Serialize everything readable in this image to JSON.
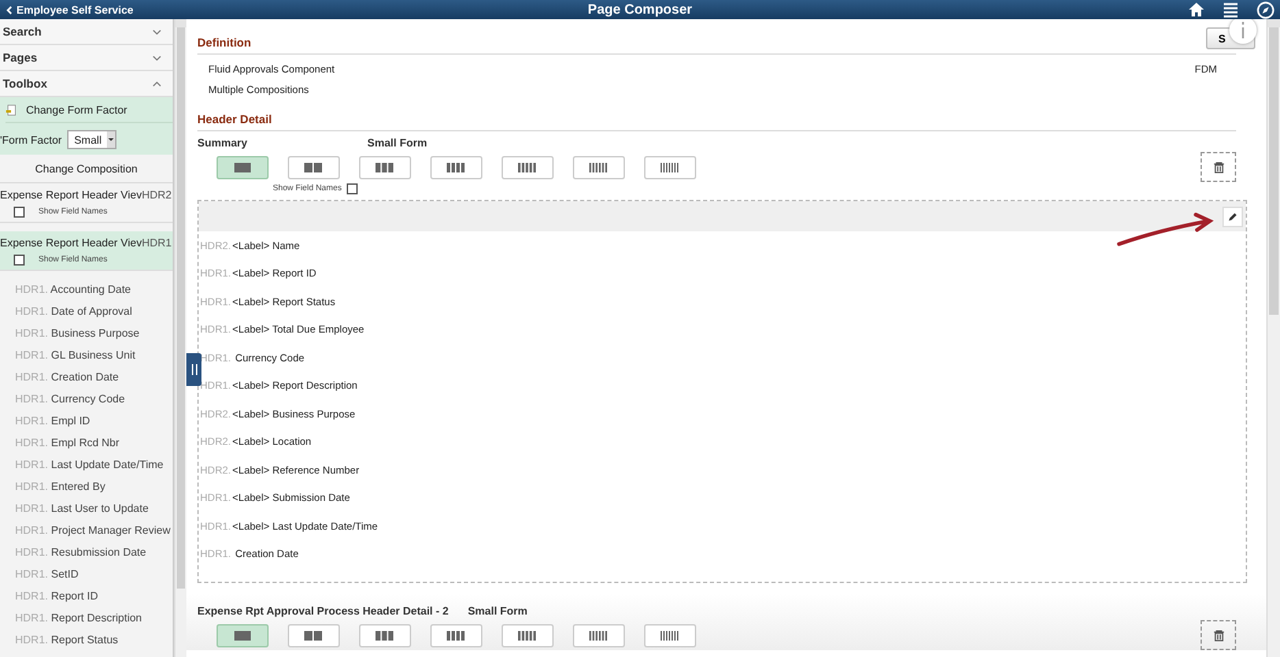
{
  "topbar": {
    "back_label": "Employee Self Service",
    "title": "Page Composer"
  },
  "sidebar": {
    "sections": [
      {
        "label": "Search",
        "expanded": false
      },
      {
        "label": "Pages",
        "expanded": false
      },
      {
        "label": "Toolbox",
        "expanded": true
      }
    ],
    "change_form_factor": "Change Form Factor",
    "form_factor_label": "'Form Factor",
    "form_factor_value": "Small",
    "change_composition": "Change Composition",
    "compositions": [
      {
        "name": "Expense Report Header Viev",
        "code": "HDR2",
        "show_field_names": "Show Field Names",
        "checked": false,
        "selected": false
      },
      {
        "name": "Expense Report Header Viev",
        "code": "HDR1",
        "show_field_names": "Show Field Names",
        "checked": false,
        "selected": true
      }
    ],
    "fields": [
      {
        "code": "HDR1.",
        "name": "Accounting Date"
      },
      {
        "code": "HDR1.",
        "name": "Date of Approval"
      },
      {
        "code": "HDR1.",
        "name": "Business Purpose"
      },
      {
        "code": "HDR1.",
        "name": "GL Business Unit"
      },
      {
        "code": "HDR1.",
        "name": "Creation Date"
      },
      {
        "code": "HDR1.",
        "name": "Currency Code"
      },
      {
        "code": "HDR1.",
        "name": "Empl ID"
      },
      {
        "code": "HDR1.",
        "name": "Empl Rcd Nbr"
      },
      {
        "code": "HDR1.",
        "name": "Last Update Date/Time"
      },
      {
        "code": "HDR1.",
        "name": "Entered By"
      },
      {
        "code": "HDR1.",
        "name": "Last User to Update"
      },
      {
        "code": "HDR1.",
        "name": "Project Manager Review"
      },
      {
        "code": "HDR1.",
        "name": "Resubmission Date"
      },
      {
        "code": "HDR1.",
        "name": "SetID"
      },
      {
        "code": "HDR1.",
        "name": "Report ID"
      },
      {
        "code": "HDR1.",
        "name": "Report Description"
      },
      {
        "code": "HDR1.",
        "name": "Report Status"
      }
    ]
  },
  "main": {
    "save_button": "S",
    "definition": {
      "heading": "Definition",
      "items": [
        "Fluid Approvals Component",
        "Multiple Compositions"
      ],
      "code": "FDM"
    },
    "sections": [
      {
        "heading": "Header Detail",
        "title": "Summary",
        "small_form_label": "Small Form",
        "layouts": [
          {
            "selected": true
          },
          {
            "selected": false
          },
          {
            "selected": false
          },
          {
            "selected": false
          },
          {
            "selected": false
          },
          {
            "selected": false
          },
          {
            "selected": false
          }
        ],
        "show_field_names": "Show Field Names",
        "checked": false,
        "rows": [
          {
            "code": "HDR2.",
            "prefix": "<Label>",
            "name": "Name"
          },
          {
            "code": "HDR1.",
            "prefix": "<Label>",
            "name": "Report ID"
          },
          {
            "code": "HDR1.",
            "prefix": "<Label>",
            "name": "Report Status"
          },
          {
            "code": "HDR1.",
            "prefix": "<Label>",
            "name": "Total Due Employee"
          },
          {
            "code": "HDR1.",
            "name": "Currency Code"
          },
          {
            "code": "HDR1.",
            "prefix": "<Label>",
            "name": "Report Description"
          },
          {
            "code": "HDR2.",
            "prefix": "<Label>",
            "name": "Business Purpose"
          },
          {
            "code": "HDR2.",
            "prefix": "<Label>",
            "name": "Location"
          },
          {
            "code": "HDR2.",
            "prefix": "<Label>",
            "name": "Reference Number"
          },
          {
            "code": "HDR1.",
            "prefix": "<Label>",
            "name": "Submission Date"
          },
          {
            "code": "HDR1.",
            "prefix": "<Label>",
            "name": "Last Update Date/Time"
          },
          {
            "code": "HDR1.",
            "name": "Creation Date"
          }
        ]
      },
      {
        "title": "Expense Rpt Approval Process Header Detail - 2",
        "small_form_label": "Small Form",
        "layouts": [
          {
            "selected": true
          },
          {
            "selected": false
          },
          {
            "selected": false
          },
          {
            "selected": false
          },
          {
            "selected": false
          },
          {
            "selected": false
          },
          {
            "selected": false
          }
        ]
      }
    ]
  }
}
